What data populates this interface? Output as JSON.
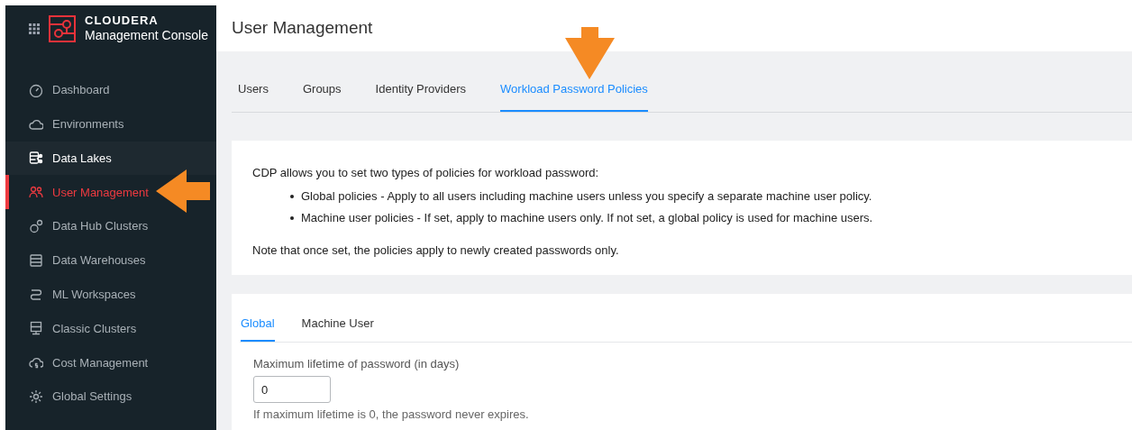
{
  "brand": {
    "name": "CLOUDERA",
    "product": "Management Console"
  },
  "sidebar": {
    "items": [
      {
        "label": "Dashboard",
        "selected": false,
        "hovered": false
      },
      {
        "label": "Environments",
        "selected": false,
        "hovered": false
      },
      {
        "label": "Data Lakes",
        "selected": false,
        "hovered": true
      },
      {
        "label": "User Management",
        "selected": true,
        "hovered": false
      },
      {
        "label": "Data Hub Clusters",
        "selected": false,
        "hovered": false
      },
      {
        "label": "Data Warehouses",
        "selected": false,
        "hovered": false
      },
      {
        "label": "ML Workspaces",
        "selected": false,
        "hovered": false
      },
      {
        "label": "Classic Clusters",
        "selected": false,
        "hovered": false
      },
      {
        "label": "Cost Management",
        "selected": false,
        "hovered": false
      },
      {
        "label": "Global Settings",
        "selected": false,
        "hovered": false
      }
    ]
  },
  "page_title": "User Management",
  "tabs": [
    {
      "label": "Users",
      "selected": false
    },
    {
      "label": "Groups",
      "selected": false
    },
    {
      "label": "Identity Providers",
      "selected": false
    },
    {
      "label": "Workload Password Policies",
      "selected": true
    }
  ],
  "info": {
    "intro": "CDP allows you to set two types of policies for workload password:",
    "bullets": [
      "Global policies - Apply to all users including machine users unless you specify a separate machine user policy.",
      "Machine user policies - If set, apply to machine users only. If not set, a global policy is used for machine users."
    ],
    "note": "Note that once set, the policies apply to newly created passwords only."
  },
  "policy_tabs": [
    {
      "label": "Global",
      "selected": true
    },
    {
      "label": "Machine User",
      "selected": false
    }
  ],
  "field": {
    "label": "Maximum lifetime of password (in days)",
    "value": "0",
    "help": "If maximum lifetime is 0, the password never expires."
  }
}
